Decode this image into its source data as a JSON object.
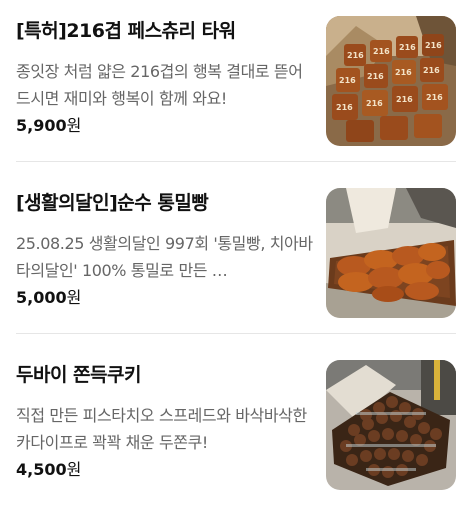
{
  "products": [
    {
      "title": "[특허]216겹 페스츄리 타워",
      "description": "종잇장 처럼 얇은 216겹의 행복 결대로 뜯어 드시면 재미와 행복이 함께 와요!",
      "price": "5,900",
      "currency": "원",
      "image_text": "216"
    },
    {
      "title": "[생활의달인]순수 통밀빵",
      "description": "25.08.25 생활의달인 997회 '통밀빵, 치아바타의달인' 100% 통밀로 만든 …",
      "price": "5,000",
      "currency": "원"
    },
    {
      "title": "두바이 쫀득쿠키",
      "description": "직접 만든 피스타치오 스프레드와 바삭바삭한 카다이프로 꽉꽉 채운 두쫀쿠!",
      "price": "4,500",
      "currency": "원"
    }
  ]
}
